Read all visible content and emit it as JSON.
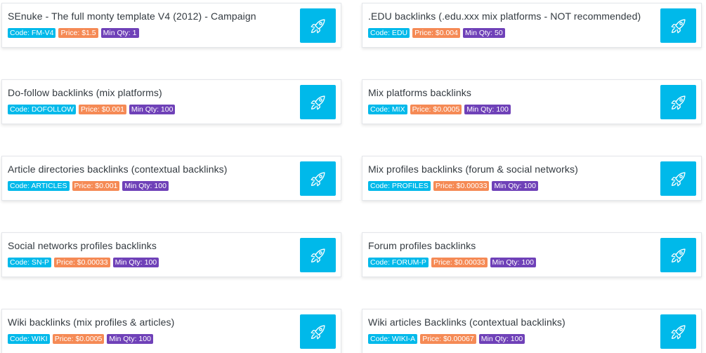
{
  "colors": {
    "code_badge": "#00b9ea",
    "price_badge": "#f58a55",
    "qty_badge": "#6f41b8",
    "launch_button": "#00b9ea"
  },
  "launch_icon": "rocket-icon",
  "products": [
    {
      "title": "SEnuke - The full monty template V4 (2012) - Campaign",
      "code": "Code: FM-V4",
      "price": "Price: $1.5",
      "min_qty": "Min Qty: 1"
    },
    {
      "title": ".EDU backlinks (.edu.xxx mix platforms - NOT recommended)",
      "code": "Code: EDU",
      "price": "Price: $0.004",
      "min_qty": "Min Qty: 50"
    },
    {
      "title": "Do-follow backlinks (mix platforms)",
      "code": "Code: DOFOLLOW",
      "price": "Price: $0.001",
      "min_qty": "Min Qty: 100"
    },
    {
      "title": "Mix platforms backlinks",
      "code": "Code: MIX",
      "price": "Price: $0.0005",
      "min_qty": "Min Qty: 100"
    },
    {
      "title": "Article directories backlinks (contextual backlinks)",
      "code": "Code: ARTICLES",
      "price": "Price: $0.001",
      "min_qty": "Min Qty: 100"
    },
    {
      "title": "Mix profiles backlinks (forum & social networks)",
      "code": "Code: PROFILES",
      "price": "Price: $0.00033",
      "min_qty": "Min Qty: 100"
    },
    {
      "title": "Social networks profiles backlinks",
      "code": "Code: SN-P",
      "price": "Price: $0.00033",
      "min_qty": "Min Qty: 100"
    },
    {
      "title": "Forum profiles backlinks",
      "code": "Code: FORUM-P",
      "price": "Price: $0.00033",
      "min_qty": "Min Qty: 100"
    },
    {
      "title": "Wiki backlinks (mix profiles & articles)",
      "code": "Code: WIKI",
      "price": "Price: $0.0005",
      "min_qty": "Min Qty: 100"
    },
    {
      "title": "Wiki articles Backlinks (contextual backlinks)",
      "code": "Code: WIKI-A",
      "price": "Price: $0.00067",
      "min_qty": "Min Qty: 100"
    }
  ]
}
